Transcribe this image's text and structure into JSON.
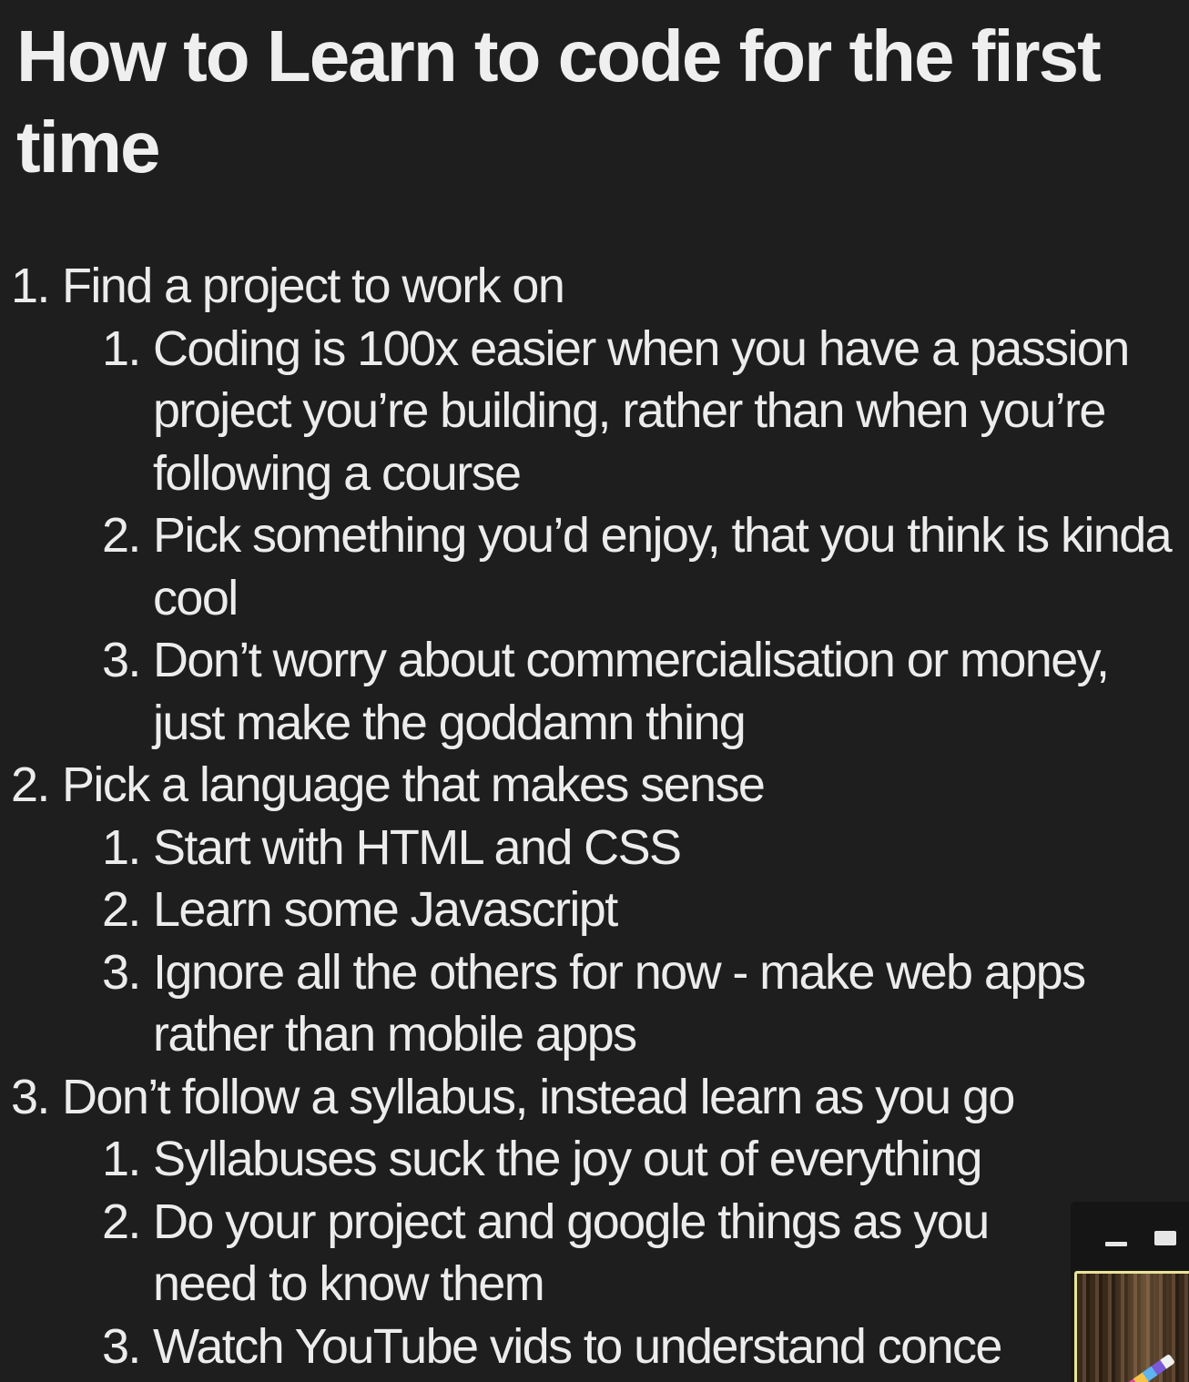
{
  "document": {
    "title": "How to Learn to code for the first time"
  },
  "outline": [
    {
      "num": "1.",
      "text": "Find a project to work on",
      "children": [
        {
          "num": "1.",
          "text": "Coding is 100x easier when you have a passion project you’re building, rather than when you’re following a course"
        },
        {
          "num": "2.",
          "text": "Pick something you’d enjoy, that you think is kinda cool"
        },
        {
          "num": "3.",
          "text": "Don’t worry about commercialisation or money, just make the goddamn thing"
        }
      ]
    },
    {
      "num": "2.",
      "text": "Pick a language that makes sense",
      "children": [
        {
          "num": "1.",
          "text": "Start with HTML and CSS"
        },
        {
          "num": "2.",
          "text": "Learn some Javascript"
        },
        {
          "num": "3.",
          "text": "Ignore all the others for now - make web apps rather than mobile apps"
        }
      ]
    },
    {
      "num": "3.",
      "text": "Don’t follow a syllabus, instead learn as you go",
      "children": [
        {
          "num": "1.",
          "text": "Syllabuses suck the joy out of everything"
        },
        {
          "num": "2.",
          "text": "Do your project and google things as you need to know them"
        },
        {
          "num": "3.",
          "text": "Watch YouTube vids to understand conce"
        }
      ]
    }
  ],
  "mini_window": {
    "minimize_icon": "minimize-icon",
    "maximize_icon": "maximize-icon",
    "thumbnail": "video-thumbnail"
  }
}
